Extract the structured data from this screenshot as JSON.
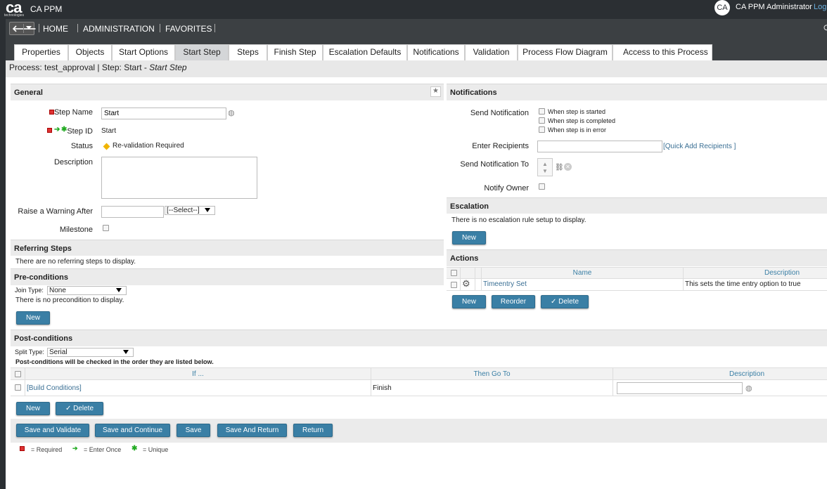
{
  "app": {
    "name": "CA PPM",
    "logo_text": "ca",
    "logo_sub": "technologies",
    "avatar": "CA",
    "user": "CA PPM Administrator",
    "logout": "Log"
  },
  "nav": {
    "items": [
      "HOME",
      "ADMINISTRATION",
      "FAVORITES"
    ]
  },
  "tabs": [
    "Properties",
    "Objects",
    "Start Options",
    "Start Step",
    "Steps",
    "Finish Step",
    "Escalation Defaults",
    "Notifications",
    "Validation",
    "Process Flow Diagram",
    "Access to this Process"
  ],
  "process": {
    "prefix": "Process: test_approval | Step: Start - ",
    "step": "Start Step"
  },
  "general": {
    "title": "General",
    "step_name_label": "Step Name",
    "step_name_value": "Start",
    "step_id_label": "Step ID",
    "step_id_value": "Start",
    "status_label": "Status",
    "status_value": "Re-validation Required",
    "description_label": "Description",
    "warning_label": "Raise a Warning After",
    "warning_select": "[--Select--]",
    "milestone_label": "Milestone"
  },
  "referring": {
    "title": "Referring Steps",
    "empty": "There are no referring steps to display."
  },
  "pre": {
    "title": "Pre-conditions",
    "join_label": "Join Type:",
    "join_value": "None",
    "empty": "There is no precondition to display.",
    "new": "New"
  },
  "post": {
    "title": "Post-conditions",
    "split_label": "Split Type:",
    "split_value": "Serial",
    "note": "Post-conditions will be checked in the order they are listed below.",
    "columns": [
      "If ...",
      "Then Go To",
      "Description"
    ],
    "row": {
      "if": "[Build Conditions]",
      "then": "Finish"
    },
    "new": "New",
    "delete": "✓ Delete"
  },
  "buttons": [
    "Save and Validate",
    "Save and Continue",
    "Save",
    "Save And Return",
    "Return"
  ],
  "legend": {
    "required": "= Required",
    "enter_once": "= Enter Once",
    "unique": "= Unique"
  },
  "notifications": {
    "title": "Notifications",
    "send_label": "Send Notification",
    "options": [
      "When step is started",
      "When step is completed",
      "When step is in error"
    ],
    "recipients_label": "Enter Recipients",
    "quick_add": "[Quick Add Recipients ]",
    "send_to_label": "Send Notification To",
    "notify_owner_label": "Notify Owner"
  },
  "escalation": {
    "title": "Escalation",
    "empty": "There is no escalation rule setup to display.",
    "new": "New"
  },
  "actions": {
    "title": "Actions",
    "columns": [
      "Name",
      "Description"
    ],
    "row": {
      "name": "Timeentry Set",
      "description": "This sets the time entry option to true"
    },
    "new": "New",
    "reorder": "Reorder",
    "delete": "✓ Delete"
  }
}
